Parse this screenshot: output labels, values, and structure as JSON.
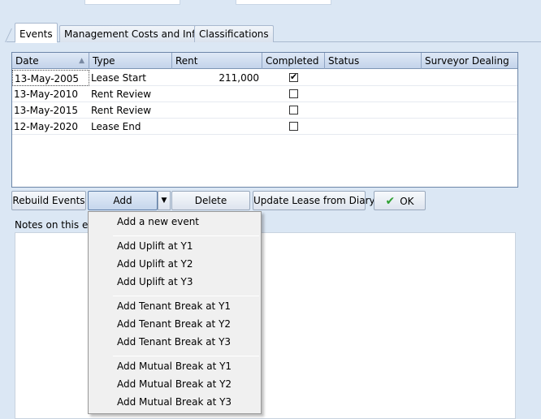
{
  "tabs": [
    "Events",
    "Management Costs and Info",
    "Classifications"
  ],
  "grid": {
    "columns": [
      "Date",
      "Type",
      "Rent",
      "Completed",
      "Status",
      "Surveyor Dealing"
    ],
    "rows": [
      {
        "date": "13-May-2005",
        "type": "Lease Start",
        "rent": "211,000",
        "completed": true
      },
      {
        "date": "13-May-2010",
        "type": "Rent Review",
        "rent": "",
        "completed": false
      },
      {
        "date": "13-May-2015",
        "type": "Rent Review",
        "rent": "",
        "completed": false
      },
      {
        "date": "12-May-2020",
        "type": "Lease End",
        "rent": "",
        "completed": false
      }
    ]
  },
  "buttons": {
    "rebuild": "Rebuild Events",
    "add": "Add",
    "delete": "Delete",
    "update": "Update Lease from Diary",
    "ok": "OK"
  },
  "notes_label": "Notes on this eve",
  "menu": {
    "items": [
      "Add a new event",
      "Add Uplift at Y1",
      "Add Uplift at Y2",
      "Add Uplift at Y3",
      "Add Tenant Break at Y1",
      "Add Tenant Break at Y2",
      "Add Tenant Break at Y3",
      "Add Mutual Break at Y1",
      "Add Mutual Break at Y2",
      "Add Mutual Break at Y3"
    ]
  },
  "icons": {
    "ok": "check-icon",
    "dropdown": "chevron-down-icon",
    "sort": "sort-asc-icon"
  }
}
